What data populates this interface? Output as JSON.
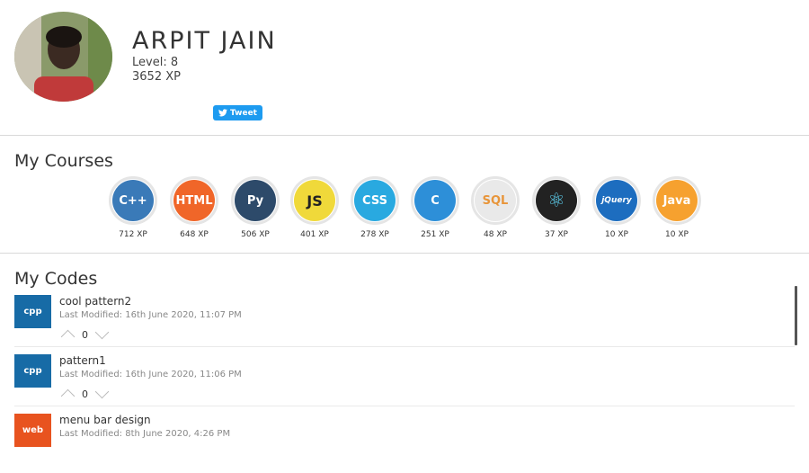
{
  "profile": {
    "name": "ARPIT JAIN",
    "level": "Level: 8",
    "xp": "3652 XP",
    "tweet_label": "Tweet"
  },
  "courses": {
    "title": "My Courses",
    "items": [
      {
        "icon": "cpp-icon",
        "label": "C++",
        "xp": "712 XP",
        "color": "#3a7ab8"
      },
      {
        "icon": "html-icon",
        "label": "HTML",
        "xp": "648 XP",
        "color": "#f06629"
      },
      {
        "icon": "python-icon",
        "label": "Py",
        "xp": "506 XP",
        "color": "#2d4a6a"
      },
      {
        "icon": "js-icon",
        "label": "JS",
        "xp": "401 XP",
        "color": "#f0d93a"
      },
      {
        "icon": "css-icon",
        "label": "CSS",
        "xp": "278 XP",
        "color": "#29a9e0"
      },
      {
        "icon": "c-icon",
        "label": "C",
        "xp": "251 XP",
        "color": "#2d8fd8"
      },
      {
        "icon": "sql-icon",
        "label": "SQL",
        "xp": "48 XP",
        "color": "#e9e9e9"
      },
      {
        "icon": "react-icon",
        "label": "⚛",
        "xp": "37 XP",
        "color": "#222222"
      },
      {
        "icon": "jquery-icon",
        "label": "jQuery",
        "xp": "10 XP",
        "color": "#1d6dbf"
      },
      {
        "icon": "java-icon",
        "label": "Java",
        "xp": "10 XP",
        "color": "#f6a12f"
      }
    ]
  },
  "codes": {
    "title": "My Codes",
    "items": [
      {
        "lang": "cpp",
        "title": "cool pattern2",
        "modified": "Last Modified: 16th June 2020, 11:07 PM",
        "votes": "0",
        "color": "#176ba6"
      },
      {
        "lang": "cpp",
        "title": "pattern1",
        "modified": "Last Modified: 16th June 2020, 11:06 PM",
        "votes": "0",
        "color": "#176ba6"
      },
      {
        "lang": "web",
        "title": "menu bar design",
        "modified": "Last Modified: 8th June 2020, 4:26 PM",
        "votes": "",
        "color": "#e8531f"
      }
    ]
  }
}
